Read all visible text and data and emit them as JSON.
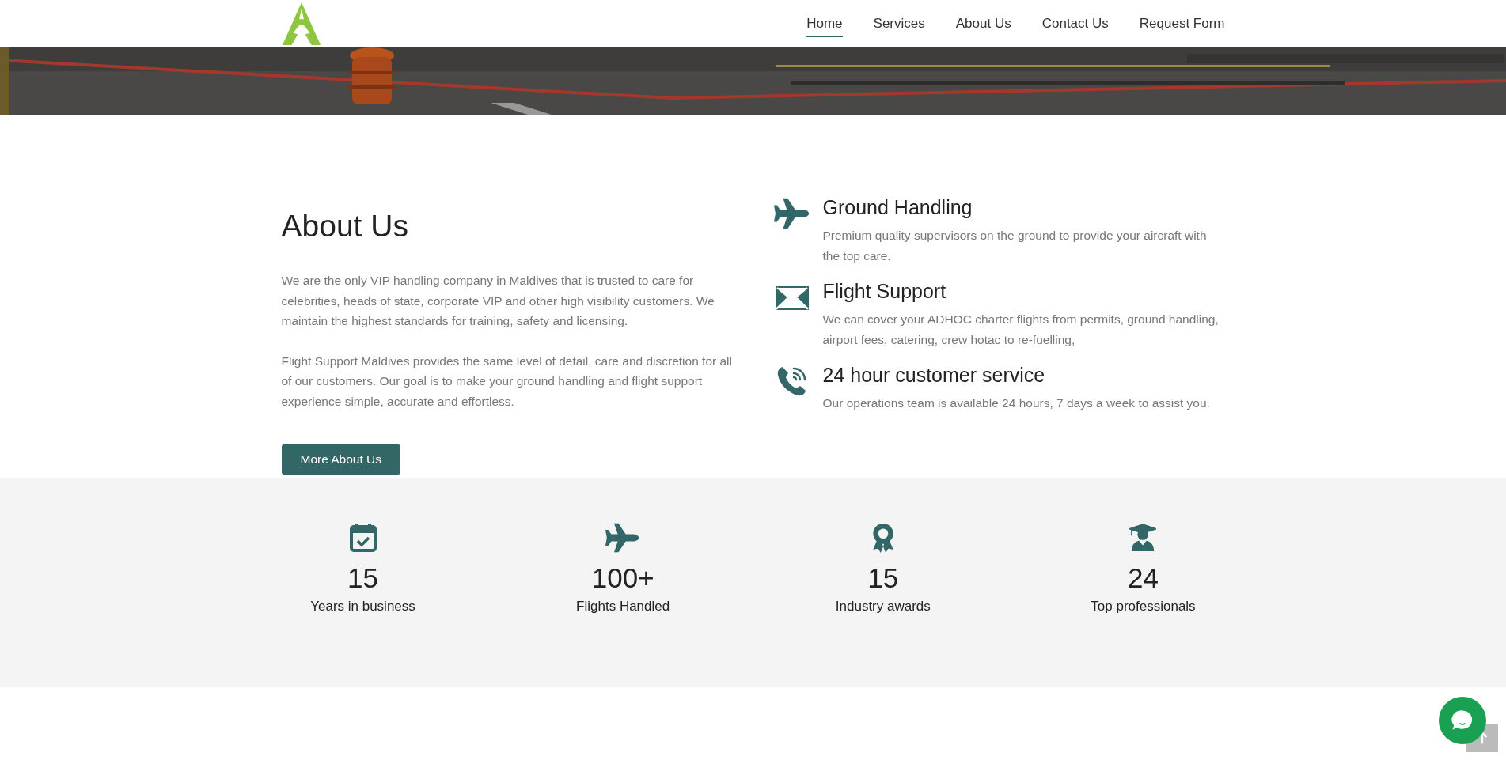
{
  "nav": [
    {
      "label": "Home",
      "selected": true
    },
    {
      "label": "Services",
      "selected": false
    },
    {
      "label": "About Us",
      "selected": false
    },
    {
      "label": "Contact Us",
      "selected": false
    },
    {
      "label": "Request Form",
      "selected": false
    }
  ],
  "about": {
    "title": "About Us",
    "paragraphs": [
      "We are the only VIP handling company in Maldives that is trusted to care for celebrities, heads of state, corporate VIP and other high visibility customers. We maintain the highest standards for training, safety and licensing.",
      "Flight Support Maldives provides the same level of detail, care and discretion for all of our customers. Our goal is to make your ground handling and flight support experience simple, accurate and effortless."
    ],
    "button": "More About Us"
  },
  "features": [
    {
      "kind": "plane",
      "title": "Ground Handling",
      "text": "Premium quality supervisors on the ground to provide your aircraft with the top care."
    },
    {
      "kind": "envelope",
      "title": "Flight Support",
      "text": "We can cover your ADHOC charter flights from permits, ground handling, airport fees, catering, crew hotac to re-fuelling,"
    },
    {
      "kind": "phone",
      "title": "24 hour customer service",
      "text": "Our operations team is available 24 hours, 7 days a week to assist you."
    }
  ],
  "stats": [
    {
      "kind": "calendar",
      "value": "15",
      "label": "Years in business"
    },
    {
      "kind": "plane",
      "value": "100+",
      "label": "Flights Handled"
    },
    {
      "kind": "award",
      "value": "15",
      "label": "Industry awards"
    },
    {
      "kind": "graduate",
      "value": "24",
      "label": "Top professionals"
    }
  ]
}
